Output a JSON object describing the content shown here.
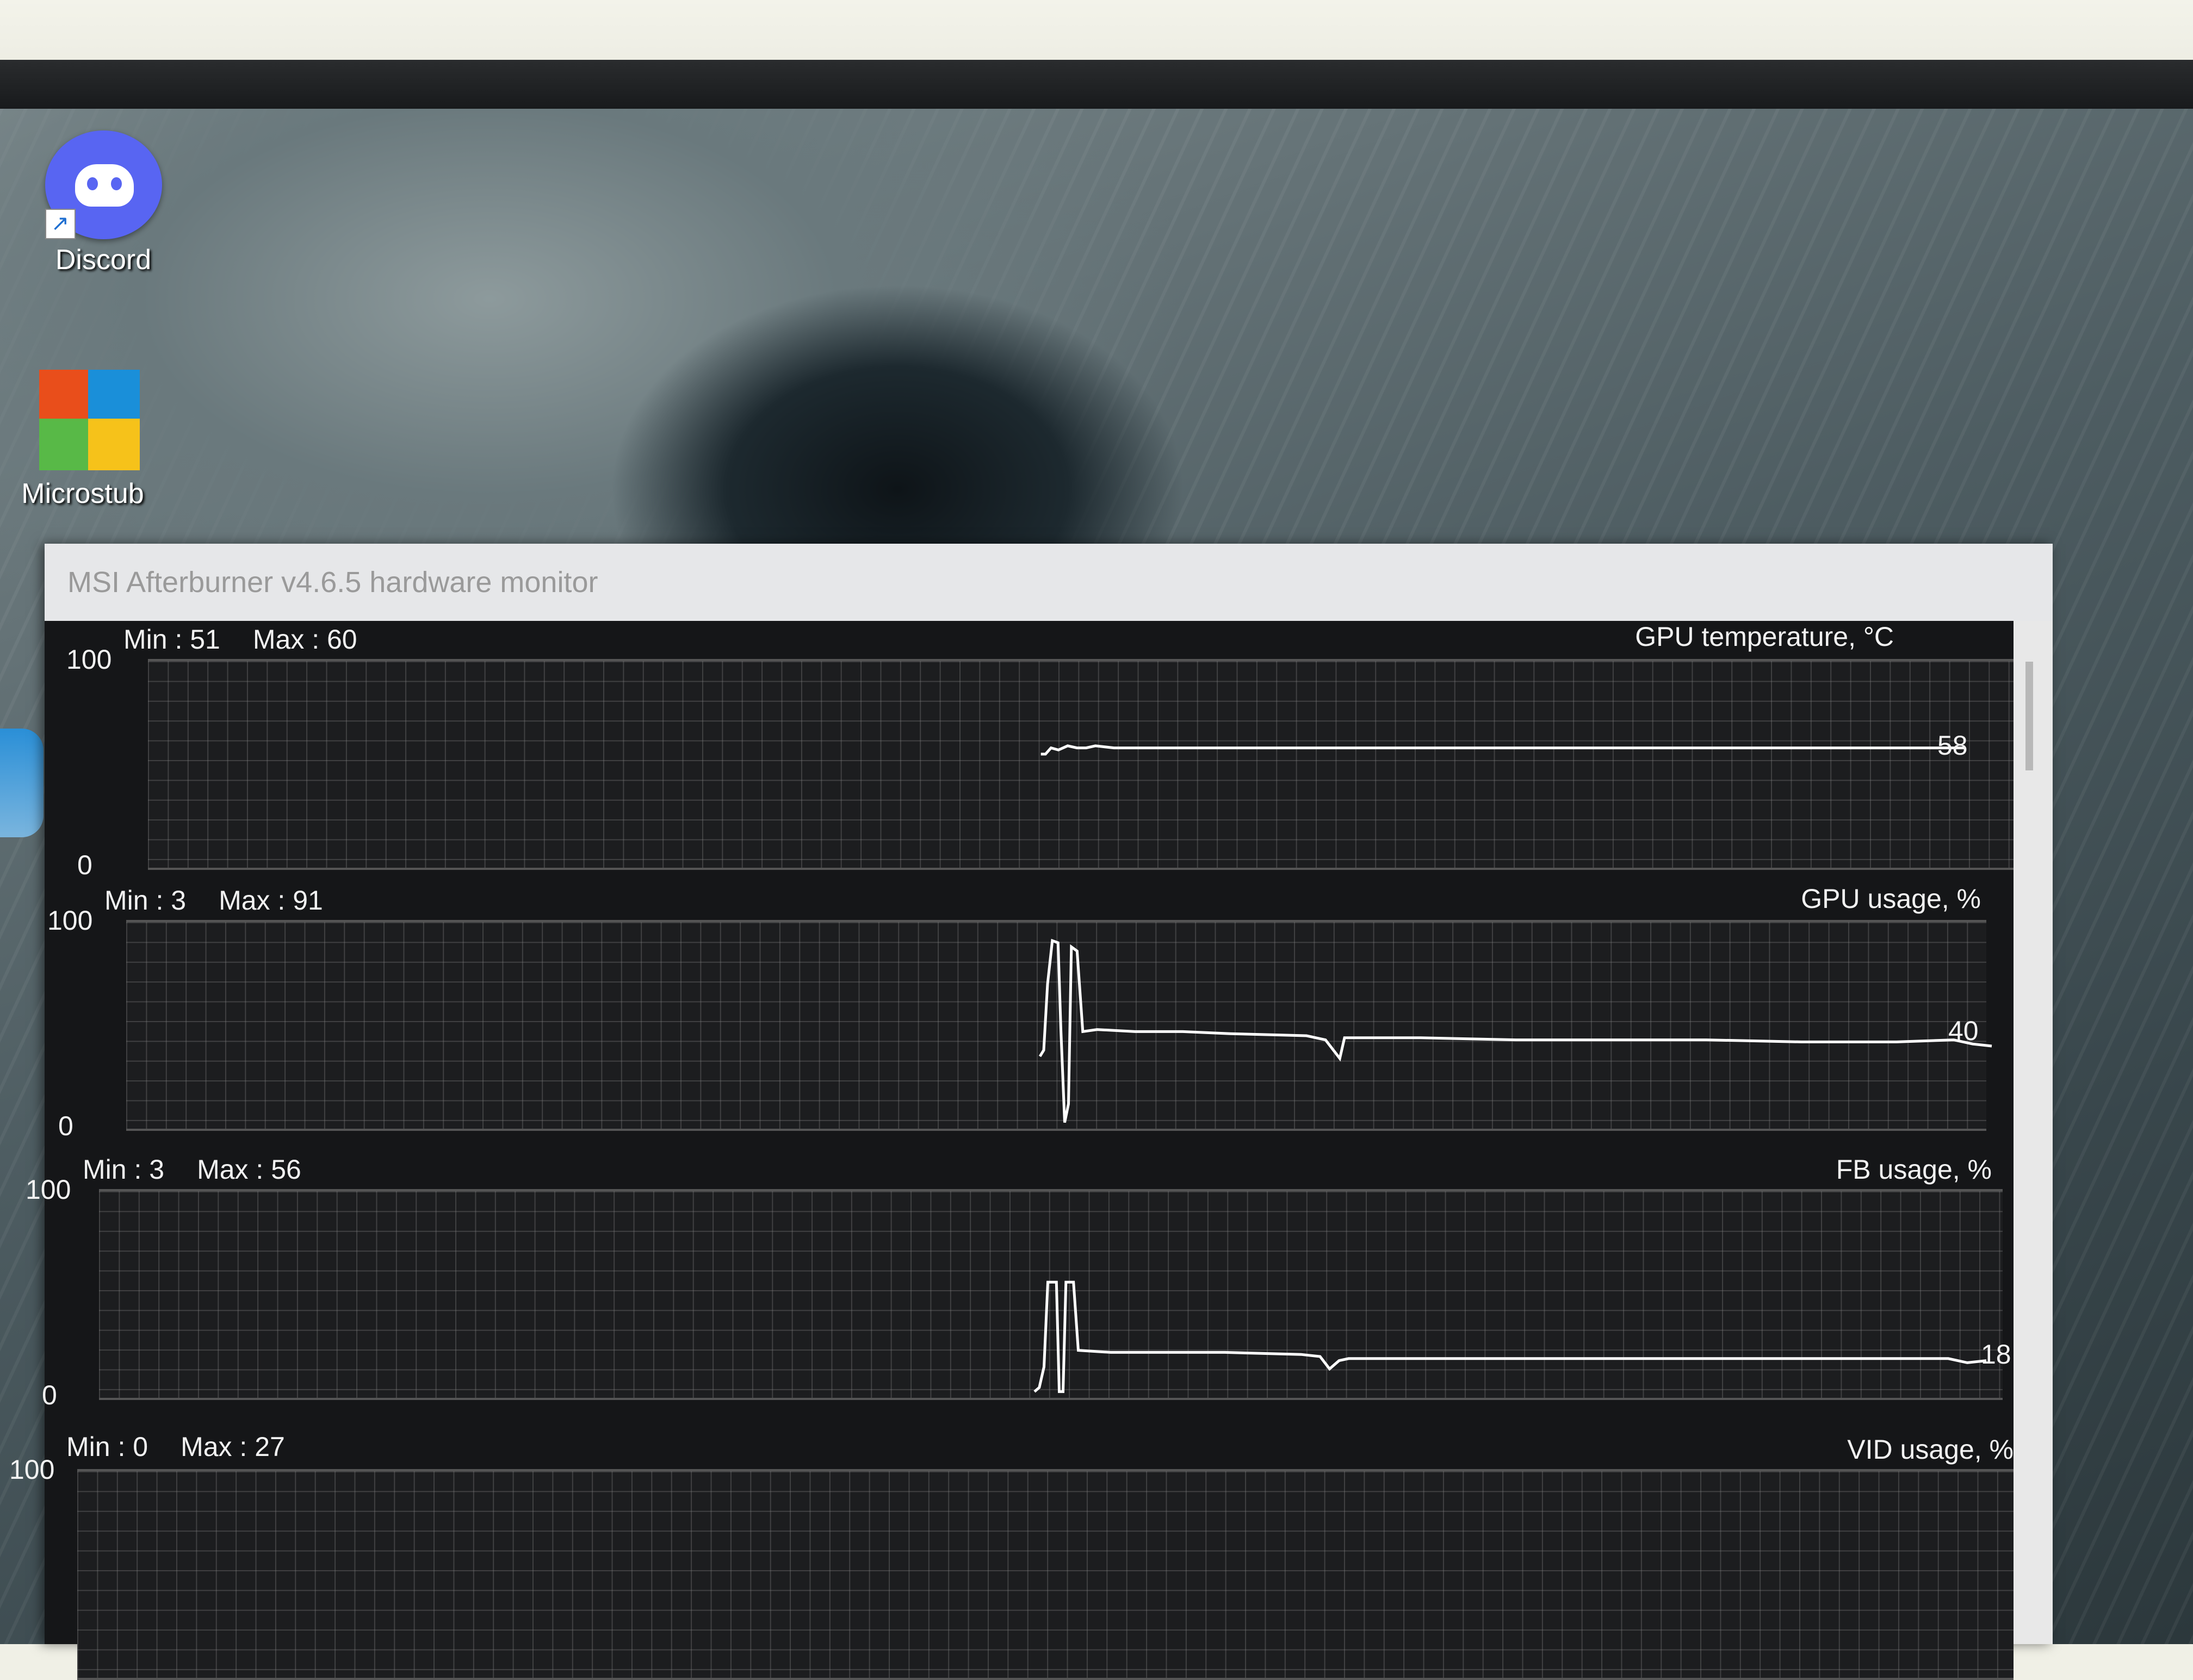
{
  "desktop": {
    "icons": [
      {
        "label": "Discord",
        "icon": "discord-icon"
      },
      {
        "label": "Microstub",
        "icon": "avg-icon"
      }
    ]
  },
  "window": {
    "title": "MSI Afterburner v4.6.5 hardware monitor"
  },
  "graphs": [
    {
      "name": "GPU temperature, °C",
      "min_label": "Min : 51",
      "max_label": "Max : 60",
      "y_max": "100",
      "y_min": "0",
      "current": "58",
      "series": [
        [
          0.1,
          55
        ],
        [
          0.6,
          55
        ],
        [
          1.2,
          58
        ],
        [
          2,
          57
        ],
        [
          3,
          59
        ],
        [
          4,
          58
        ],
        [
          5,
          58
        ],
        [
          6,
          59
        ],
        [
          8,
          58
        ],
        [
          20,
          58
        ],
        [
          40,
          58
        ],
        [
          60,
          58
        ],
        [
          80,
          58
        ],
        [
          100,
          58
        ]
      ]
    },
    {
      "name": "GPU usage, %",
      "min_label": "Min : 3",
      "max_label": "Max : 91",
      "y_max": "100",
      "y_min": "0",
      "current": "40",
      "series": [
        [
          0,
          35
        ],
        [
          0.4,
          38
        ],
        [
          0.8,
          70
        ],
        [
          1.3,
          91
        ],
        [
          1.9,
          90
        ],
        [
          2.2,
          48
        ],
        [
          2.6,
          3
        ],
        [
          3,
          12
        ],
        [
          3.3,
          88
        ],
        [
          3.9,
          86
        ],
        [
          4.5,
          47
        ],
        [
          6,
          48
        ],
        [
          10,
          47
        ],
        [
          15,
          47
        ],
        [
          20,
          46
        ],
        [
          28,
          45
        ],
        [
          30,
          43
        ],
        [
          31.5,
          34
        ],
        [
          32,
          44
        ],
        [
          33,
          44
        ],
        [
          40,
          44
        ],
        [
          50,
          43
        ],
        [
          60,
          43
        ],
        [
          70,
          43
        ],
        [
          80,
          42
        ],
        [
          90,
          42
        ],
        [
          96,
          43
        ],
        [
          98,
          41
        ],
        [
          100,
          40
        ]
      ]
    },
    {
      "name": "FB usage, %",
      "min_label": "Min : 3",
      "max_label": "Max : 56",
      "y_max": "100",
      "y_min": "0",
      "current": "18",
      "series": [
        [
          0,
          3
        ],
        [
          0.5,
          5
        ],
        [
          1,
          15
        ],
        [
          1.4,
          56
        ],
        [
          2.3,
          56
        ],
        [
          2.6,
          3
        ],
        [
          3,
          3
        ],
        [
          3.3,
          56
        ],
        [
          4.1,
          56
        ],
        [
          4.6,
          23
        ],
        [
          8,
          22
        ],
        [
          14,
          22
        ],
        [
          20,
          22
        ],
        [
          28,
          21
        ],
        [
          30,
          20
        ],
        [
          31,
          14
        ],
        [
          32,
          18
        ],
        [
          33,
          19
        ],
        [
          40,
          19
        ],
        [
          50,
          19
        ],
        [
          60,
          19
        ],
        [
          70,
          19
        ],
        [
          80,
          19
        ],
        [
          90,
          19
        ],
        [
          96,
          19
        ],
        [
          98,
          17
        ],
        [
          100,
          18
        ]
      ]
    },
    {
      "name": "VID usage, %",
      "min_label": "Min : 0",
      "max_label": "Max : 27",
      "y_max": "100",
      "y_min": "0",
      "current": "",
      "series": []
    }
  ],
  "colors": {
    "line": "#ffffff",
    "grid": "#5a5a5a",
    "bg": "#1a1b1d"
  }
}
